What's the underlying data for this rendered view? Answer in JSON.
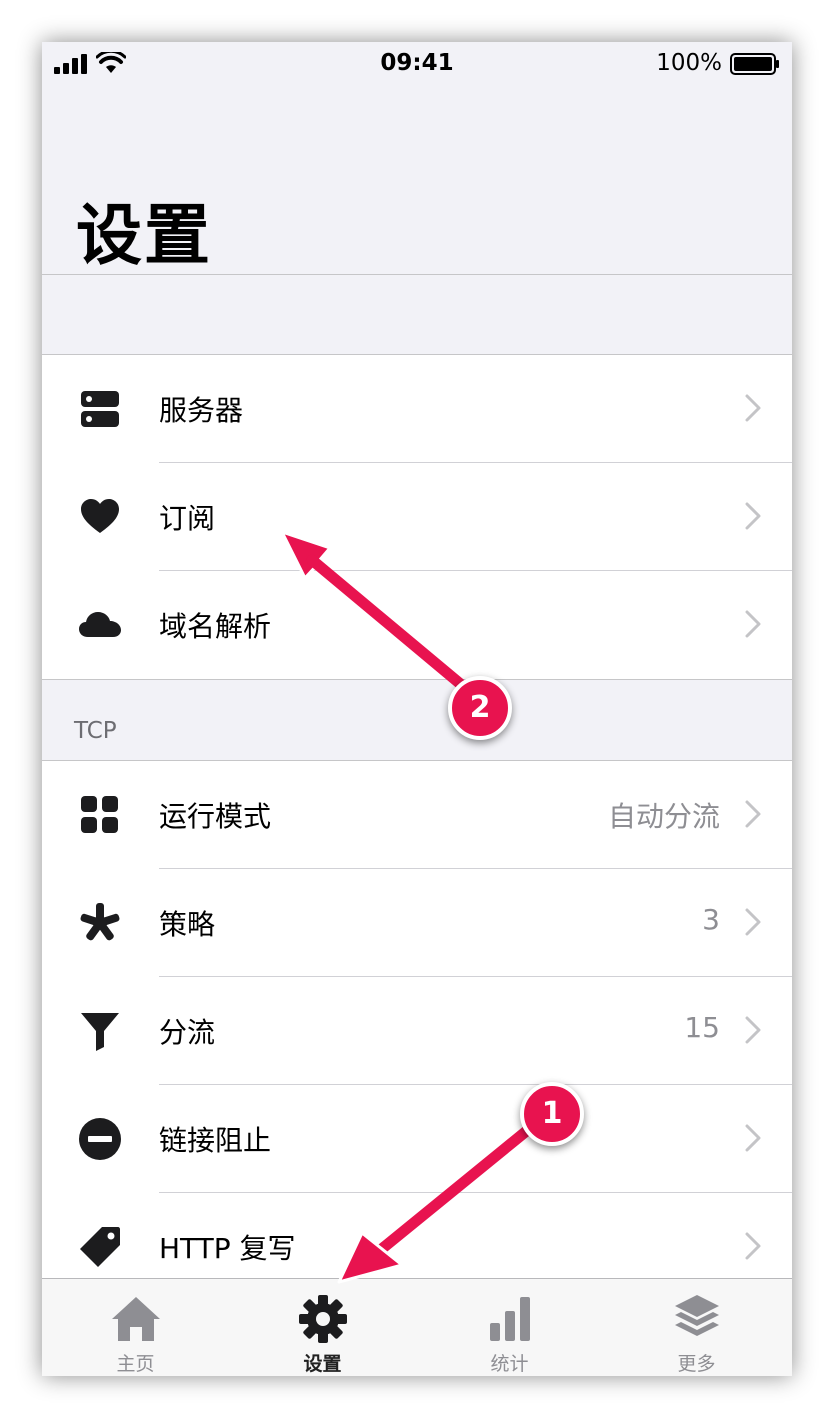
{
  "status_bar": {
    "time": "09:41",
    "battery": "100%"
  },
  "page": {
    "title": "设置"
  },
  "groups": {
    "first": [
      {
        "label": "服务器",
        "value": "",
        "icon": "server-icon"
      },
      {
        "label": "订阅",
        "value": "",
        "icon": "heart-icon"
      },
      {
        "label": "域名解析",
        "value": "",
        "icon": "cloud-icon"
      }
    ],
    "tcp_header": "TCP",
    "tcp": [
      {
        "label": "运行模式",
        "value": "自动分流",
        "icon": "grid-icon"
      },
      {
        "label": "策略",
        "value": "3",
        "icon": "asterisk-icon"
      },
      {
        "label": "分流",
        "value": "15",
        "icon": "filter-icon"
      },
      {
        "label": "链接阻止",
        "value": "",
        "icon": "minus-circle-icon"
      },
      {
        "label": "HTTP 复写",
        "value": "",
        "icon": "tag-icon"
      }
    ]
  },
  "tabbar": [
    {
      "label": "主页",
      "icon": "home-icon",
      "active": false
    },
    {
      "label": "设置",
      "icon": "gear-icon",
      "active": true
    },
    {
      "label": "统计",
      "icon": "bar-chart-icon",
      "active": false
    },
    {
      "label": "更多",
      "icon": "layers-icon",
      "active": false
    }
  ],
  "annotations": [
    {
      "number": "1"
    },
    {
      "number": "2"
    }
  ],
  "colors": {
    "annotation": "#e8134f",
    "accent_text": "#000000",
    "secondary_text": "#8e8e93"
  }
}
